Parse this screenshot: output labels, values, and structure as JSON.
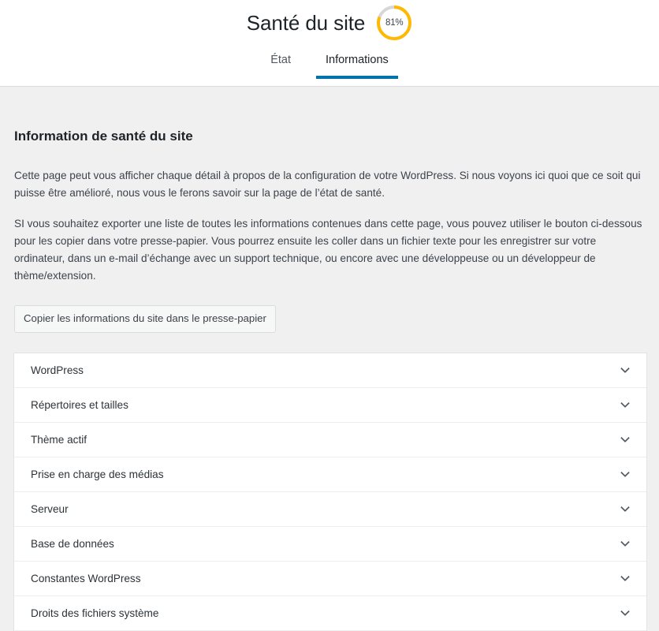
{
  "header": {
    "title": "Santé du site",
    "progress": {
      "value": 81,
      "label": "81%",
      "arc_color": "#ffb900",
      "track_color": "#d7d7d9"
    },
    "tabs": [
      {
        "label": "État",
        "active": false
      },
      {
        "label": "Informations",
        "active": true
      }
    ],
    "accent_color": "#0073aa"
  },
  "main": {
    "heading": "Information de santé du site",
    "paragraph_1": "Cette page peut vous afficher chaque détail à propos de la configuration de votre WordPress. Si nous voyons ici quoi que ce soit qui puisse être amélioré, nous vous le ferons savoir sur la page de l’état de santé.",
    "paragraph_2": "SI vous souhaitez exporter une liste de toutes les informations contenues dans cette page, vous pouvez utiliser le bouton ci-dessous pour les copier dans votre presse-papier. Vous pourrez ensuite les coller dans un fichier texte pour les enregistrer sur votre ordinateur, dans un e-mail d’échange avec un support technique, ou encore avec une développeuse ou un développeur de thème/extension.",
    "copy_button": "Copier les informations du site dans le presse-papier",
    "sections": [
      {
        "label": "WordPress",
        "icon": "chevron-down-icon",
        "expanded": false
      },
      {
        "label": "Répertoires et tailles",
        "icon": "chevron-down-icon",
        "expanded": false
      },
      {
        "label": "Thème actif",
        "icon": "chevron-down-icon",
        "expanded": false
      },
      {
        "label": "Prise en charge des médias",
        "icon": "chevron-down-icon",
        "expanded": false
      },
      {
        "label": "Serveur",
        "icon": "chevron-down-icon",
        "expanded": false
      },
      {
        "label": "Base de données",
        "icon": "chevron-down-icon",
        "expanded": false
      },
      {
        "label": "Constantes WordPress",
        "icon": "chevron-down-icon",
        "expanded": false
      },
      {
        "label": "Droits des fichiers système",
        "icon": "chevron-down-icon",
        "expanded": false
      }
    ]
  }
}
